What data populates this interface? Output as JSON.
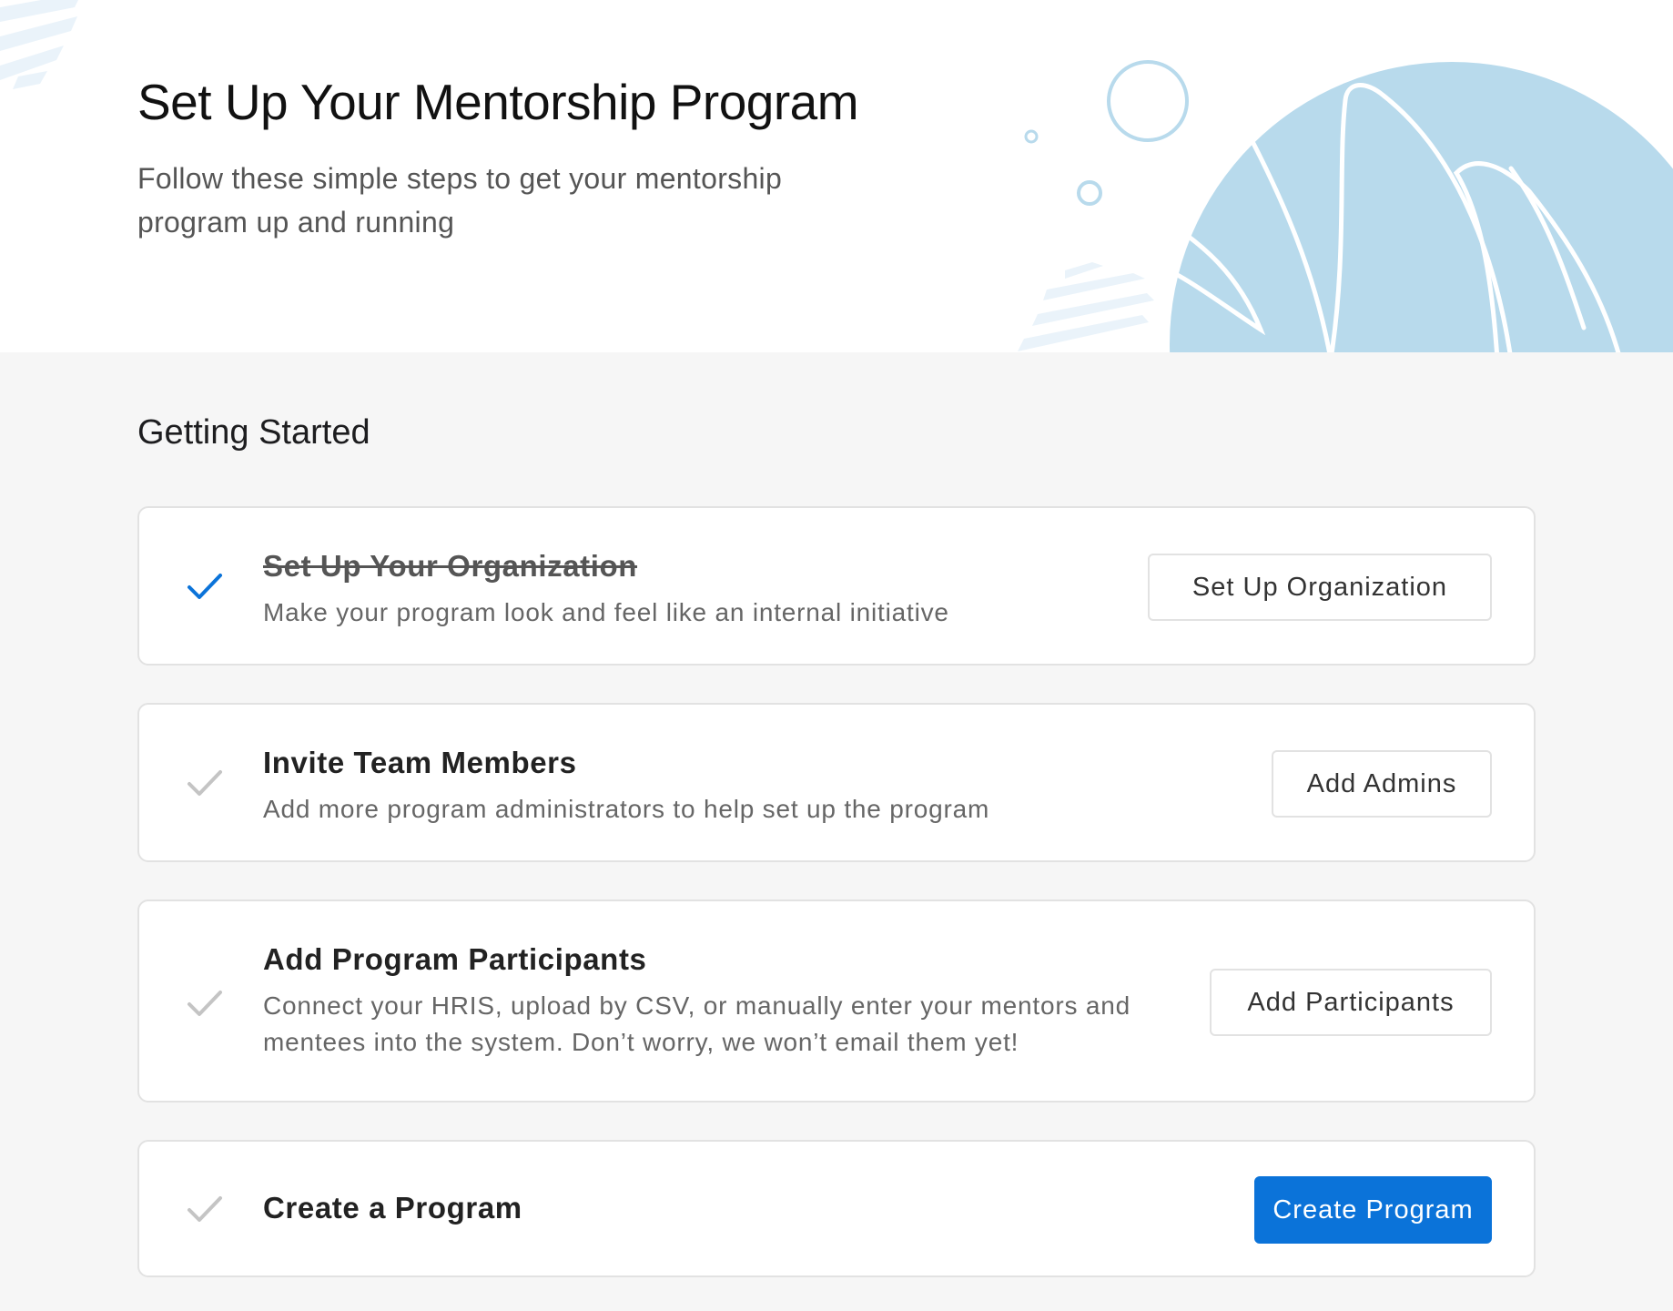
{
  "header": {
    "title": "Set Up Your Mentorship Program",
    "subtitle": "Follow these simple steps to get your mentorship program up and running"
  },
  "section": {
    "title": "Getting Started"
  },
  "steps": [
    {
      "title": "Set Up Your Organization",
      "description": "Make your program look and feel like an internal initiative",
      "button_label": "Set Up Organization",
      "completed": true
    },
    {
      "title": "Invite Team Members",
      "description": "Add more program administrators to help set up the program",
      "button_label": "Add Admins",
      "completed": false
    },
    {
      "title": "Add Program Participants",
      "description": "Connect your HRIS, upload by CSV, or manually enter your mentors and mentees into the system. Don’t worry, we won’t email them yet!",
      "button_label": "Add Participants",
      "completed": false
    },
    {
      "title": "Create a Program",
      "description": "",
      "button_label": "Create Program",
      "completed": false
    }
  ],
  "colors": {
    "accent": "#0b73d9",
    "check_done": "#0b73d9",
    "check_pending": "#c4c4c4",
    "hero_art": "#b8daec",
    "page_background": "#f6f6f6"
  }
}
